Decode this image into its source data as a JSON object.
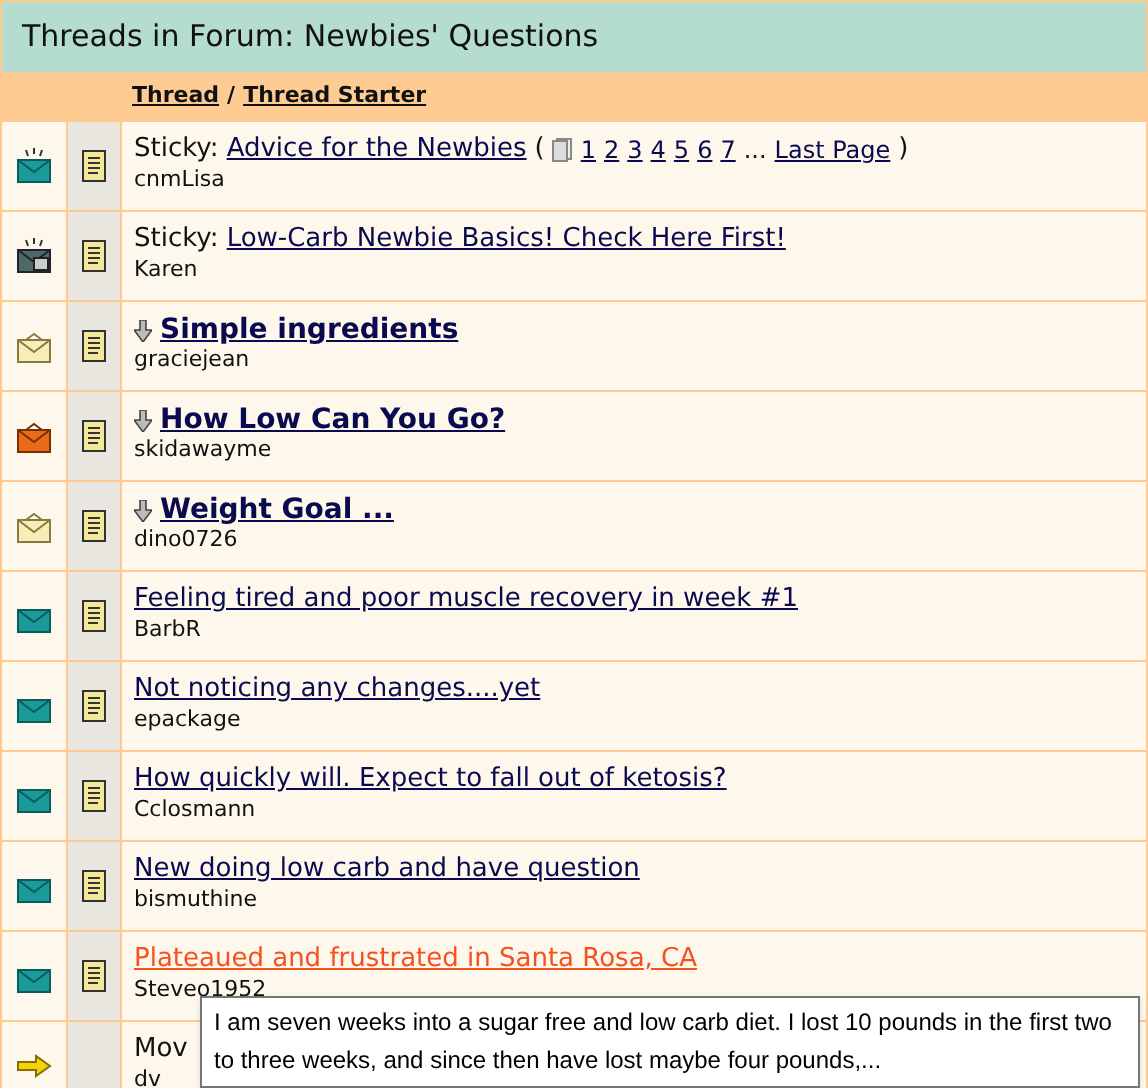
{
  "forum_title": "Threads in Forum: Newbies' Questions",
  "columns": [
    {
      "label": "Thread"
    },
    {
      "label": "Thread Starter"
    }
  ],
  "column_separator": "/",
  "threads": [
    {
      "kind": "new-hot",
      "prefix": "Sticky:",
      "title": "Advice for the Newbies",
      "bold": false,
      "marked": false,
      "hovered": false,
      "starter": "cnmLisa",
      "pages": {
        "open": "(",
        "numbers": [
          "1",
          "2",
          "3",
          "4",
          "5",
          "6",
          "7"
        ],
        "ellipsis": "...",
        "last": "Last Page",
        "close": ")"
      }
    },
    {
      "kind": "locked",
      "prefix": "Sticky:",
      "title": "Low-Carb Newbie Basics! Check Here First!",
      "bold": false,
      "marked": false,
      "hovered": false,
      "starter": "Karen"
    },
    {
      "kind": "read-hot",
      "title": "Simple ingredients",
      "bold": true,
      "marked": true,
      "hovered": false,
      "starter": "graciejean"
    },
    {
      "kind": "posted-hot",
      "title": "How Low Can You Go?",
      "bold": true,
      "marked": true,
      "hovered": false,
      "starter": "skidawayme"
    },
    {
      "kind": "read-hot",
      "title": "Weight Goal ...",
      "bold": true,
      "marked": true,
      "hovered": false,
      "starter": "dino0726"
    },
    {
      "kind": "new",
      "title": "Feeling tired and poor muscle recovery in week #1",
      "bold": false,
      "marked": false,
      "hovered": false,
      "starter": "BarbR"
    },
    {
      "kind": "new",
      "title": "Not noticing any changes....yet",
      "bold": false,
      "marked": false,
      "hovered": false,
      "starter": "epackage"
    },
    {
      "kind": "new",
      "title": "How quickly will. Expect to fall out of ketosis?",
      "bold": false,
      "marked": false,
      "hovered": false,
      "starter": "Cclosmann"
    },
    {
      "kind": "new",
      "title": "New doing low carb and have question",
      "bold": false,
      "marked": false,
      "hovered": false,
      "starter": "bismuthine"
    },
    {
      "kind": "new",
      "title": "Plateaued and frustrated in Santa Rosa, CA",
      "bold": false,
      "marked": false,
      "hovered": true,
      "starter": "Steveo1952"
    },
    {
      "kind": "moved",
      "title": "Mov",
      "bold": false,
      "marked": false,
      "hovered": false,
      "plain": true,
      "starter": "dv"
    }
  ],
  "tooltip": {
    "text": "I am seven weeks into a sugar free and low carb diet.  I lost 10 pounds in the first two to three weeks, and since then have lost maybe four pounds,..."
  }
}
